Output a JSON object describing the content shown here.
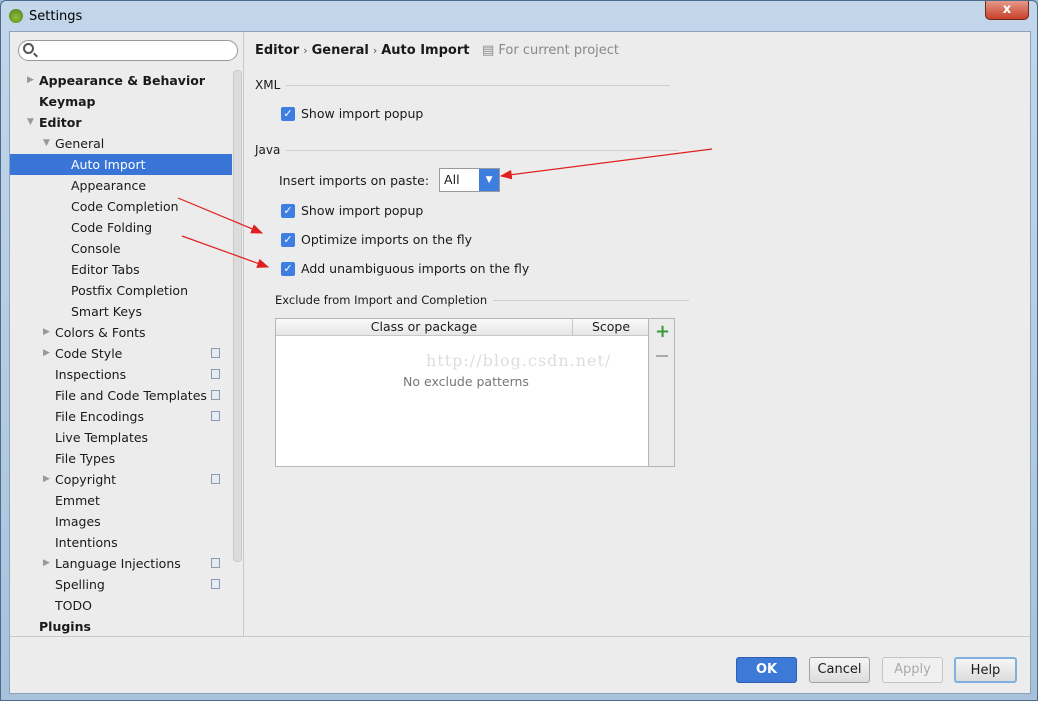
{
  "window": {
    "title": "Settings",
    "close_label": "x"
  },
  "sidebar": {
    "search_placeholder": "",
    "items": [
      {
        "label": "Appearance & Behavior",
        "level": 0,
        "bold": true,
        "arrow": "right"
      },
      {
        "label": "Keymap",
        "level": 0,
        "bold": true
      },
      {
        "label": "Editor",
        "level": 0,
        "bold": true,
        "arrow": "down"
      },
      {
        "label": "General",
        "level": 1,
        "arrow": "down"
      },
      {
        "label": "Auto Import",
        "level": 2,
        "selected": true
      },
      {
        "label": "Appearance",
        "level": 2
      },
      {
        "label": "Code Completion",
        "level": 2
      },
      {
        "label": "Code Folding",
        "level": 2
      },
      {
        "label": "Console",
        "level": 2
      },
      {
        "label": "Editor Tabs",
        "level": 2
      },
      {
        "label": "Postfix Completion",
        "level": 2
      },
      {
        "label": "Smart Keys",
        "level": 2
      },
      {
        "label": "Colors & Fonts",
        "level": 1,
        "arrow": "right"
      },
      {
        "label": "Code Style",
        "level": 1,
        "arrow": "right",
        "project": true
      },
      {
        "label": "Inspections",
        "level": 1,
        "project": true
      },
      {
        "label": "File and Code Templates",
        "level": 1,
        "project": true
      },
      {
        "label": "File Encodings",
        "level": 1,
        "project": true
      },
      {
        "label": "Live Templates",
        "level": 1
      },
      {
        "label": "File Types",
        "level": 1
      },
      {
        "label": "Copyright",
        "level": 1,
        "arrow": "right",
        "project": true
      },
      {
        "label": "Emmet",
        "level": 1
      },
      {
        "label": "Images",
        "level": 1
      },
      {
        "label": "Intentions",
        "level": 1
      },
      {
        "label": "Language Injections",
        "level": 1,
        "arrow": "right",
        "project": true
      },
      {
        "label": "Spelling",
        "level": 1,
        "project": true
      },
      {
        "label": "TODO",
        "level": 1
      },
      {
        "label": "Plugins",
        "level": 0,
        "bold": true
      }
    ]
  },
  "breadcrumb": {
    "items": [
      "Editor",
      "General",
      "Auto Import"
    ],
    "scope": "For current project"
  },
  "xml": {
    "section": "XML",
    "show_import_popup": {
      "label": "Show import popup",
      "checked": true
    }
  },
  "java": {
    "section": "Java",
    "insert_label": "Insert imports on paste:",
    "insert_value": "All",
    "show_import_popup": {
      "label": "Show import popup",
      "checked": true
    },
    "optimize": {
      "label": "Optimize imports on the fly",
      "checked": true
    },
    "unambiguous": {
      "label": "Add unambiguous imports on the fly",
      "checked": true
    }
  },
  "exclude": {
    "section": "Exclude from Import and Completion",
    "columns": [
      "Class or package",
      "Scope"
    ],
    "empty_text": "No exclude patterns",
    "watermark": "http://blog.csdn.net/"
  },
  "buttons": {
    "ok": "OK",
    "cancel": "Cancel",
    "apply": "Apply",
    "help": "Help"
  },
  "colors": {
    "accent": "#3d7ee0",
    "selection": "#3875d7",
    "annotation": "#e02020"
  }
}
